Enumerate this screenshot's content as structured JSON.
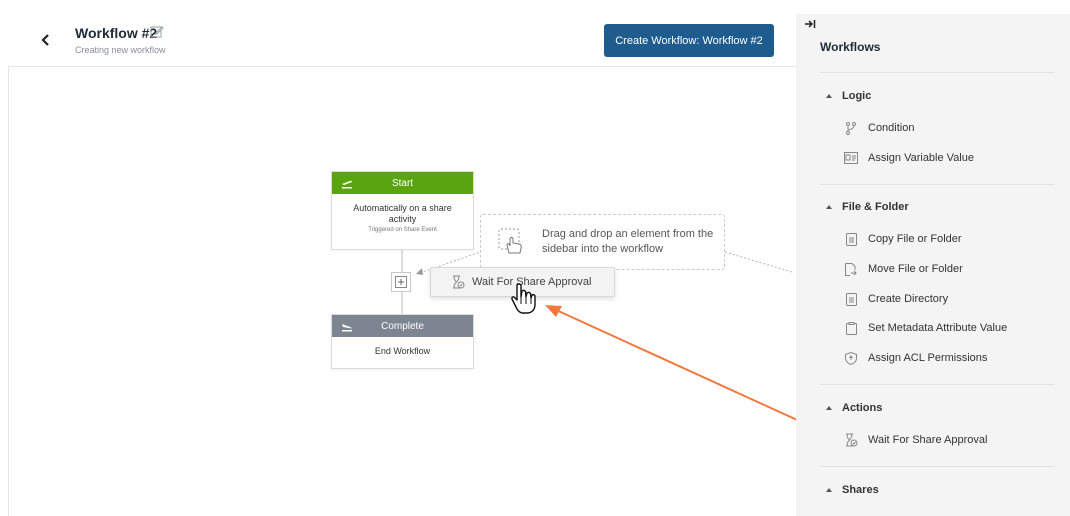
{
  "header": {
    "title": "Workflow #2",
    "subtitle": "Creating new workflow",
    "create_button": "Create Workflow: Workflow #2"
  },
  "canvas": {
    "start_node": {
      "header": "Start",
      "body": "Automatically on a share activity",
      "sub": "Triggered on Share Event",
      "color": "#5aa50f"
    },
    "complete_node": {
      "header": "Complete",
      "body": "End Workflow",
      "color": "#7d8591"
    },
    "dropzone_text": "Drag and drop an element from the sidebar into the workflow",
    "drag_ghost_label": "Wait For Share Approval"
  },
  "sidebar": {
    "title": "Workflows",
    "sections": [
      {
        "label": "Logic",
        "items": [
          {
            "label": "Condition",
            "icon": "branch-icon"
          },
          {
            "label": "Assign Variable Value",
            "icon": "variable-icon"
          }
        ]
      },
      {
        "label": "File & Folder",
        "items": [
          {
            "label": "Copy File or Folder",
            "icon": "file-icon"
          },
          {
            "label": "Move File or Folder",
            "icon": "move-file-icon"
          },
          {
            "label": "Create Directory",
            "icon": "file-icon"
          },
          {
            "label": "Set Metadata Attribute Value",
            "icon": "clipboard-icon"
          },
          {
            "label": "Assign ACL Permissions",
            "icon": "shield-icon"
          }
        ]
      },
      {
        "label": "Actions",
        "items": [
          {
            "label": "Wait For Share Approval",
            "icon": "hourglass-icon"
          }
        ]
      },
      {
        "label": "Shares",
        "items": []
      }
    ]
  },
  "colors": {
    "accent_button": "#1e5c8e",
    "annotation_arrow": "#f0793f"
  }
}
